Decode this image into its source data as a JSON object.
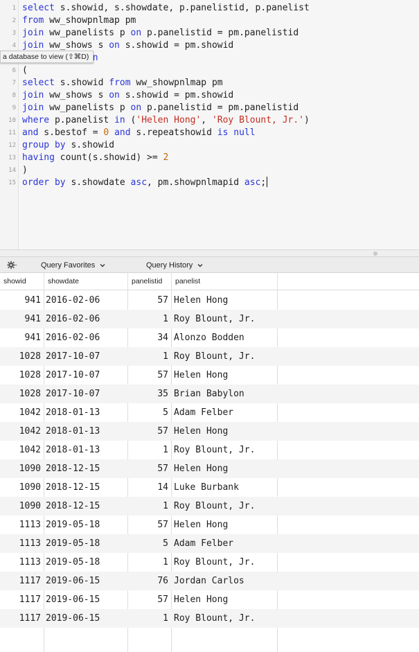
{
  "editor": {
    "lines": [
      {
        "num": "1",
        "tokens": [
          [
            "k",
            "select"
          ],
          [
            "p",
            " s.showid, s.showdate, p.panelistid, p.panelist"
          ]
        ]
      },
      {
        "num": "2",
        "tokens": [
          [
            "k",
            "from"
          ],
          [
            "p",
            " ww_showpnlmap pm"
          ]
        ]
      },
      {
        "num": "3",
        "tokens": [
          [
            "k",
            "join"
          ],
          [
            "p",
            " ww_panelists p "
          ],
          [
            "k",
            "on"
          ],
          [
            "p",
            " p.panelistid = pm.panelistid"
          ]
        ]
      },
      {
        "num": "4",
        "tokens": [
          [
            "k",
            "join"
          ],
          [
            "p",
            " ww_shows s "
          ],
          [
            "k",
            "on"
          ],
          [
            "p",
            " s.showid = pm.showid"
          ]
        ]
      },
      {
        "num": "5",
        "tokens": [
          [
            "p",
            "          d "
          ],
          [
            "k",
            "in"
          ]
        ]
      },
      {
        "num": "6",
        "tokens": [
          [
            "p",
            "("
          ]
        ]
      },
      {
        "num": "7",
        "tokens": [
          [
            "k",
            "select"
          ],
          [
            "p",
            " s.showid "
          ],
          [
            "k",
            "from"
          ],
          [
            "p",
            " ww_showpnlmap pm"
          ]
        ]
      },
      {
        "num": "8",
        "tokens": [
          [
            "k",
            "join"
          ],
          [
            "p",
            " ww_shows s "
          ],
          [
            "k",
            "on"
          ],
          [
            "p",
            " s.showid = pm.showid"
          ]
        ]
      },
      {
        "num": "9",
        "tokens": [
          [
            "k",
            "join"
          ],
          [
            "p",
            " ww_panelists p "
          ],
          [
            "k",
            "on"
          ],
          [
            "p",
            " p.panelistid = pm.panelistid"
          ]
        ]
      },
      {
        "num": "10",
        "tokens": [
          [
            "k",
            "where"
          ],
          [
            "p",
            " p.panelist "
          ],
          [
            "k",
            "in"
          ],
          [
            "p",
            " ("
          ],
          [
            "s",
            "'Helen Hong'"
          ],
          [
            "p",
            ", "
          ],
          [
            "s",
            "'Roy Blount, Jr.'"
          ],
          [
            "p",
            ")"
          ]
        ]
      },
      {
        "num": "11",
        "tokens": [
          [
            "k",
            "and"
          ],
          [
            "p",
            " s.bestof = "
          ],
          [
            "n",
            "0"
          ],
          [
            "p",
            " "
          ],
          [
            "k",
            "and"
          ],
          [
            "p",
            " s.repeatshowid "
          ],
          [
            "k",
            "is"
          ],
          [
            "p",
            " "
          ],
          [
            "k",
            "null"
          ]
        ]
      },
      {
        "num": "12",
        "tokens": [
          [
            "k",
            "group by"
          ],
          [
            "p",
            " s.showid"
          ]
        ]
      },
      {
        "num": "13",
        "tokens": [
          [
            "k",
            "having"
          ],
          [
            "p",
            " count(s.showid) >= "
          ],
          [
            "n",
            "2"
          ]
        ]
      },
      {
        "num": "14",
        "tokens": [
          [
            "p",
            ")"
          ]
        ]
      },
      {
        "num": "15",
        "tokens": [
          [
            "k",
            "order by"
          ],
          [
            "p",
            " s.showdate "
          ],
          [
            "k",
            "asc"
          ],
          [
            "p",
            ", pm.showpnlmapid "
          ],
          [
            "k",
            "asc"
          ],
          [
            "p",
            ";"
          ]
        ]
      }
    ],
    "tooltip": "a database to view (⇧⌘D)"
  },
  "toolbar": {
    "gear_icon": "gear-icon",
    "favorites_label": "Query Favorites",
    "history_label": "Query History"
  },
  "grid": {
    "columns": [
      "showid",
      "showdate",
      "panelistid",
      "panelist"
    ],
    "rows": [
      [
        "941",
        "2016-02-06",
        "57",
        "Helen Hong"
      ],
      [
        "941",
        "2016-02-06",
        "1",
        "Roy Blount, Jr."
      ],
      [
        "941",
        "2016-02-06",
        "34",
        "Alonzo Bodden"
      ],
      [
        "1028",
        "2017-10-07",
        "1",
        "Roy Blount, Jr."
      ],
      [
        "1028",
        "2017-10-07",
        "57",
        "Helen Hong"
      ],
      [
        "1028",
        "2017-10-07",
        "35",
        "Brian Babylon"
      ],
      [
        "1042",
        "2018-01-13",
        "5",
        "Adam Felber"
      ],
      [
        "1042",
        "2018-01-13",
        "57",
        "Helen Hong"
      ],
      [
        "1042",
        "2018-01-13",
        "1",
        "Roy Blount, Jr."
      ],
      [
        "1090",
        "2018-12-15",
        "57",
        "Helen Hong"
      ],
      [
        "1090",
        "2018-12-15",
        "14",
        "Luke Burbank"
      ],
      [
        "1090",
        "2018-12-15",
        "1",
        "Roy Blount, Jr."
      ],
      [
        "1113",
        "2019-05-18",
        "57",
        "Helen Hong"
      ],
      [
        "1113",
        "2019-05-18",
        "5",
        "Adam Felber"
      ],
      [
        "1113",
        "2019-05-18",
        "1",
        "Roy Blount, Jr."
      ],
      [
        "1117",
        "2019-06-15",
        "76",
        "Jordan Carlos"
      ],
      [
        "1117",
        "2019-06-15",
        "57",
        "Helen Hong"
      ],
      [
        "1117",
        "2019-06-15",
        "1",
        "Roy Blount, Jr."
      ]
    ]
  },
  "colors": {
    "keyword": "#2a35d8",
    "string": "#c22d22",
    "number": "#c46a0b",
    "row_alt": "#f4f4f4"
  }
}
